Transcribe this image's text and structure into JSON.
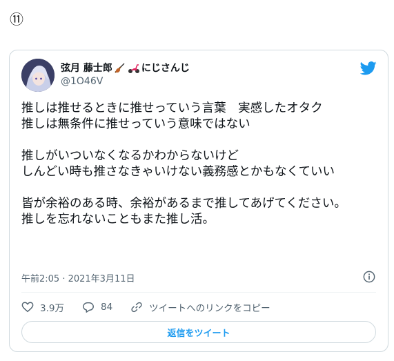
{
  "marker": "⑪",
  "tweet": {
    "author": {
      "name": "弦月 藤士郎",
      "name_suffix": "にじさんじ",
      "handle": "@1O46V",
      "emoji_icons": [
        "violin-emoji",
        "scooter-emoji"
      ]
    },
    "lines": [
      "推しは推せるときに推せっていう言葉　実感したオタク",
      "推しは無条件に推せっていう意味ではない",
      "",
      "推しがいついなくなるかわからないけど",
      "しんどい時も推さなきゃいけない義務感とかもなくていい",
      "",
      "皆が余裕のある時、余裕があるまで推してあげてください。",
      "推しを忘れないこともまた推し活。"
    ],
    "timestamp": "午前2:05 · 2021年3月11日",
    "likes": "3.9万",
    "replies": "84",
    "copy_link_label": "ツイートへのリンクをコピー",
    "reply_button": "返信をツイート"
  },
  "colors": {
    "accent": "#1d9bf0",
    "muted": "#536471",
    "border": "#cfd9de"
  }
}
